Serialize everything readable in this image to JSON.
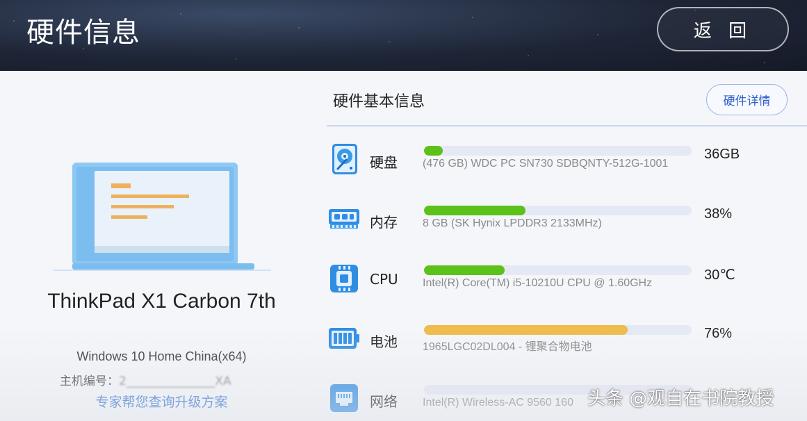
{
  "header": {
    "title": "硬件信息",
    "back_label": "返 回"
  },
  "device": {
    "name": "ThinkPad X1 Carbon 7th",
    "os": "Windows 10 Home China(x64)",
    "host_label": "主机编号：",
    "host_value": "2_______________XA",
    "upgrade_link": "专家帮您查询升级方案"
  },
  "hardware": {
    "section_title": "硬件基本信息",
    "details_label": "硬件详情",
    "items": [
      {
        "icon": "hard-disk-icon",
        "label": "硬盘",
        "desc": "(476 GB) WDC PC SN730 SDBQNTY-512G-1001",
        "value": "36GB",
        "usage": 0.07,
        "color": "#5cc21a"
      },
      {
        "icon": "memory-icon",
        "label": "内存",
        "desc": "8 GB (SK Hynix LPDDR3 2133MHz)",
        "value": "38%",
        "usage": 0.38,
        "color": "#5cc21a"
      },
      {
        "icon": "cpu-icon",
        "label": "CPU",
        "desc": "Intel(R) Core(TM) i5-10210U CPU @ 1.60GHz",
        "value": "30℃",
        "usage": 0.3,
        "color": "#5cc21a"
      },
      {
        "icon": "battery-icon",
        "label": "电池",
        "desc": "1965LGC02DL004 - 锂聚合物电池",
        "value": "76%",
        "usage": 0.76,
        "color": "#efbb4b"
      },
      {
        "icon": "network-icon",
        "label": "网络",
        "desc": "Intel(R) Wireless-AC 9560 160",
        "value": "",
        "usage": 0,
        "color": "#5cc21a"
      }
    ]
  },
  "watermark": "头条 @观自在书院教授"
}
